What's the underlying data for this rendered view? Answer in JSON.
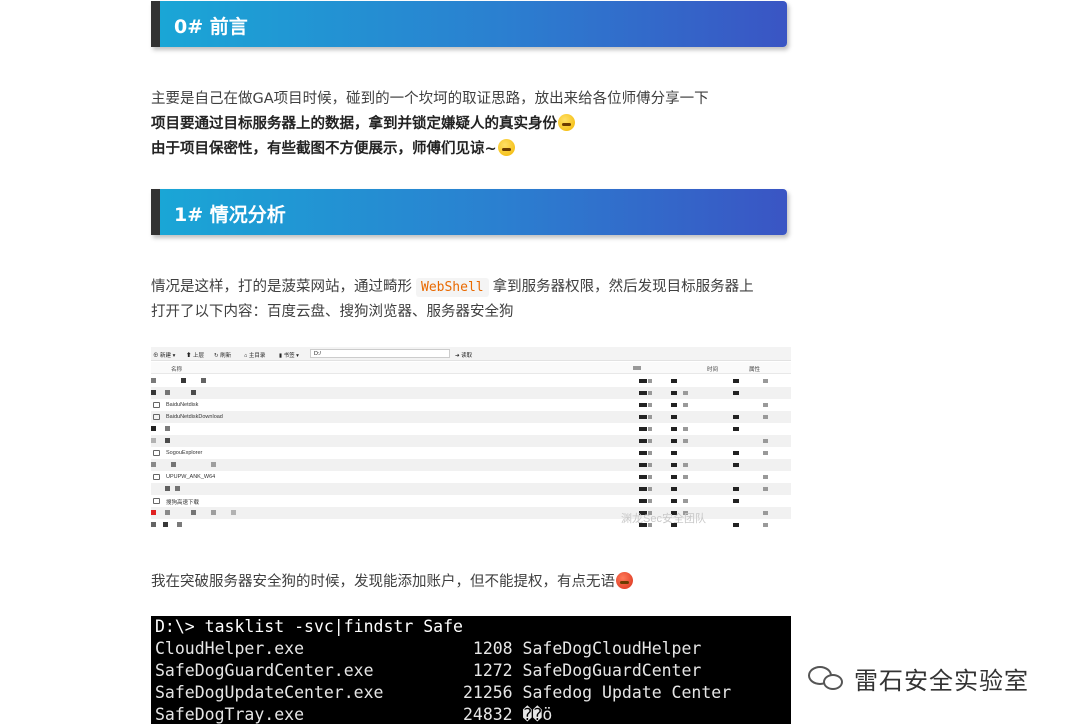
{
  "sections": [
    {
      "heading": "0# 前言"
    },
    {
      "heading": "1# 情况分析"
    }
  ],
  "intro": {
    "line1": "主要是自己在做GA项目时候，碰到的一个坎坷的取证思路，放出来给各位师傅分享一下",
    "line2": "项目要通过目标服务器上的数据，拿到并锁定嫌疑人的真实身份",
    "line3": "由于项目保密性，有些截图不方便展示，师傅们见谅~"
  },
  "analysis": {
    "line1_before": "情况是这样，打的是菠菜网站，通过畸形",
    "line1_code": "WebShell",
    "line1_after": "拿到服务器权限，然后发现目标服务器上",
    "line2": "打开了以下内容：百度云盘、搜狗浏览器、服务器安全狗",
    "line3": "我在突破服务器安全狗的时候，发现能添加账户，但不能提权，有点无语"
  },
  "file_browser": {
    "toolbar": {
      "new_label": "新建",
      "up_label": "上层",
      "refresh_label": "刷新",
      "home_label": "主目录",
      "bookmark_label": "书签",
      "path_value": "D:/",
      "read_label": "读取"
    },
    "columns": {
      "name": "名称",
      "date": "时间",
      "size": "大小",
      "perm": "属性"
    },
    "rows": [
      {
        "name": ""
      },
      {
        "name": ""
      },
      {
        "name": "BaiduNetdisk"
      },
      {
        "name": "BaiduNetdiskDownload"
      },
      {
        "name": ""
      },
      {
        "name": ""
      },
      {
        "name": "SogouExplorer"
      },
      {
        "name": ""
      },
      {
        "name": "UPUPW_ANK_W64"
      },
      {
        "name": ""
      },
      {
        "name": "搜狗高速下载"
      },
      {
        "name": ""
      },
      {
        "name": ""
      }
    ],
    "watermark": "渊龙Sec安全团队"
  },
  "terminal": {
    "command": "D:\\> tasklist -svc|findstr Safe",
    "lines": [
      "CloudHelper.exe                 1208 SafeDogCloudHelper",
      "SafeDogGuardCenter.exe          1272 SafeDogGuardCenter",
      "SafeDogUpdateCenter.exe        21256 Safedog Update Center",
      "SafeDogTray.exe                24832 ��ö"
    ]
  },
  "brand": {
    "name": "雷石安全实验室"
  },
  "icons": {
    "emoji1": "flushed-face-icon",
    "emoji2": "rolling-laughing-face-icon",
    "emoji3": "angry-face-icon",
    "brand_icon": "wechat-icon"
  }
}
